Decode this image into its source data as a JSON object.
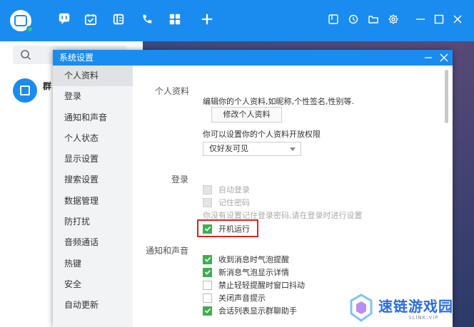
{
  "app": {
    "nav_icons": [
      "chat-icon",
      "calendar-icon",
      "docs-icon",
      "phone-icon",
      "apps-icon",
      "plus-icon"
    ],
    "window_icons": [
      "notes-icon",
      "history-icon",
      "folder-icon",
      "settings-icon",
      "minimize-icon",
      "maximize-icon",
      "close-icon"
    ],
    "contact_name": "群"
  },
  "dialog": {
    "title": "系统设置",
    "menu": [
      "个人资料",
      "登录",
      "通知和声音",
      "个人状态",
      "显示设置",
      "搜索设置",
      "数据管理",
      "防打扰",
      "音频通话",
      "热键",
      "安全",
      "自动更新"
    ],
    "active_menu": "个人资料"
  },
  "profile": {
    "section": "个人资料",
    "desc": "编辑你的个人资料,如昵称,个性签名,性别等.",
    "edit_button": "修改个人资料",
    "perm_desc": "你可以设置你的个人资料开放权限",
    "perm_value": "仅好友可见"
  },
  "login": {
    "section": "登录",
    "auto_login": "自动登录",
    "remember_pwd": "记住密码",
    "hint": "你没有设置记住登录密码,请在登录时进行设置",
    "startup": "开机运行"
  },
  "notify": {
    "section": "通知和声音",
    "items": [
      {
        "label": "收到消息时气泡提醒",
        "checked": true
      },
      {
        "label": "新消息气泡显示详情",
        "checked": true
      },
      {
        "label": "禁止轻轻提醒时窗口抖动",
        "checked": false
      },
      {
        "label": "关闭声音提示",
        "checked": false
      },
      {
        "label": "会话列表显示群聊助手",
        "checked": true
      }
    ]
  },
  "watermark": {
    "name": "速链游戏园",
    "sub": "SLINK.VIP"
  },
  "colors": {
    "brand": "#1a8cf0",
    "check": "#3cb04b",
    "highlight": "#e02020"
  }
}
